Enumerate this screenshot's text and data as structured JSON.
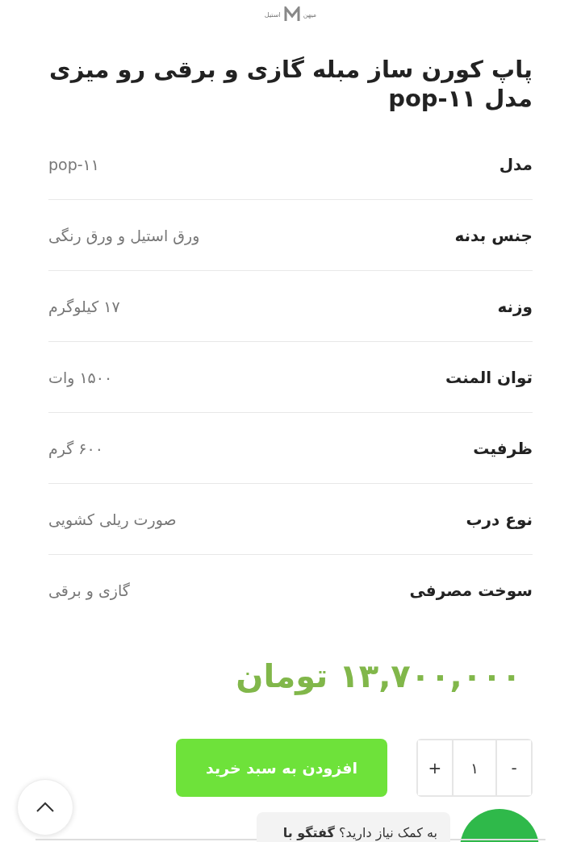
{
  "logo": {
    "name": "میهن",
    "subtitle": "استیل"
  },
  "title": "پاپ کورن ساز مبله گازی و برقی رو میزی مدل pop-۱۱",
  "specs": [
    {
      "label": "مدل",
      "value": "pop-۱۱"
    },
    {
      "label": "جنس بدنه",
      "value": "ورق استیل و ورق رنگی"
    },
    {
      "label": "وزنه",
      "value": "۱۷ کیلوگرم"
    },
    {
      "label": "توان المنت",
      "value": "۱۵۰۰ وات"
    },
    {
      "label": "ظرفیت",
      "value": "۶۰۰ گرم"
    },
    {
      "label": "نوع درب",
      "value": "صورت ریلی کشویی"
    },
    {
      "label": "سوخت مصرفی",
      "value": "گازی و برقی"
    }
  ],
  "price": "۱۳,۷۰۰,۰۰۰ تومان",
  "quantity": {
    "minus": "-",
    "value": "۱",
    "plus": "+"
  },
  "add_to_cart": "افزودن به سبد خرید",
  "chat_prompt": "به کمک نیاز دارید؟ **گفتگو با**"
}
